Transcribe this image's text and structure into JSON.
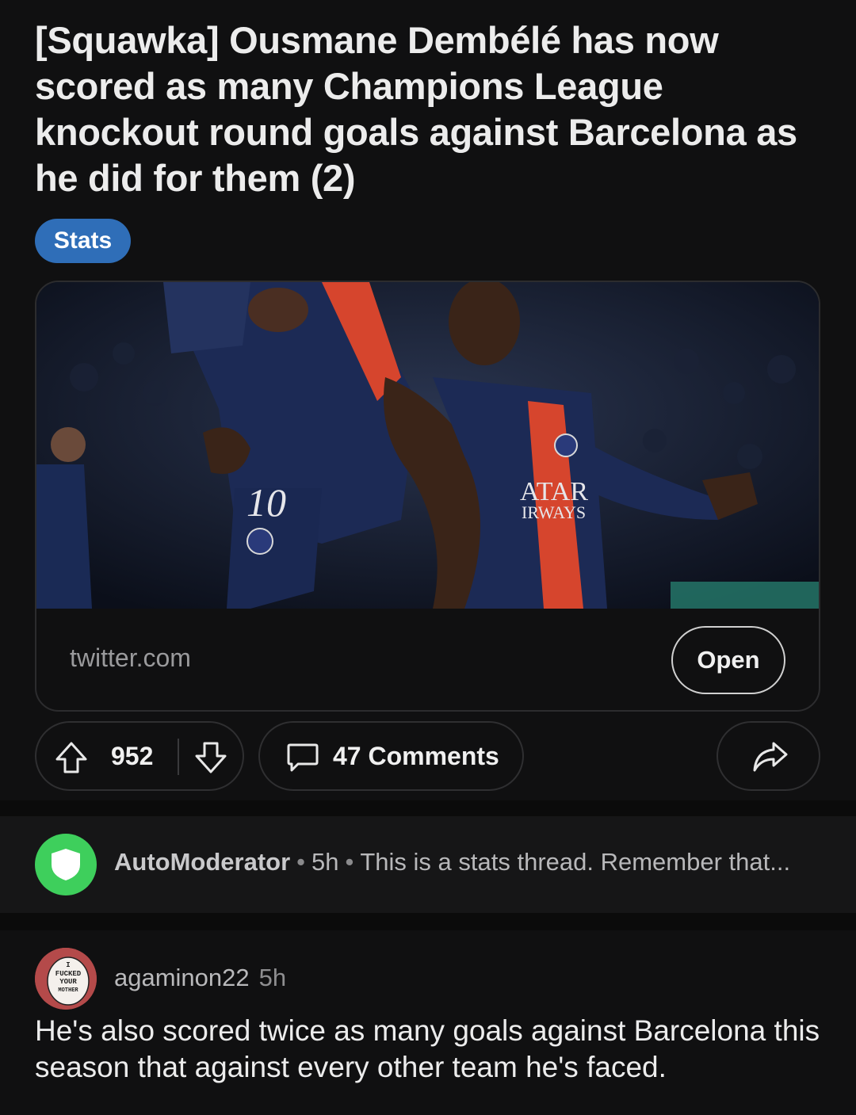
{
  "post": {
    "title": "[Squawka] Ousmane Dembélé has now scored as many Champions League knockout round goals against Barcelona as he did for them (2)",
    "flair": "Stats",
    "link": {
      "domain": "twitter.com",
      "open_label": "Open",
      "image_text": {
        "shirt_number": "10",
        "sponsor_line1": "ATAR",
        "sponsor_line2": "IRWAYS"
      }
    },
    "actions": {
      "score": "952",
      "comments_label": "47 Comments"
    }
  },
  "automod": {
    "author": "AutoModerator",
    "time": "5h",
    "preview": "This is a stats thread. Remember that..."
  },
  "comment": {
    "author": "agaminon22",
    "time": "5h",
    "body": "He's also scored twice as many goals against Barcelona this season that against every other team he's faced.",
    "avatar_text": {
      "line1": "I",
      "line2": "FUCKED",
      "line3": "YOUR",
      "line4": "MOTHER"
    }
  },
  "colors": {
    "background": "#101011",
    "flair": "#2f6eb8",
    "automod_avatar": "#3ecf5c",
    "kit_navy": "#1c2a55",
    "kit_red": "#d6452d"
  }
}
